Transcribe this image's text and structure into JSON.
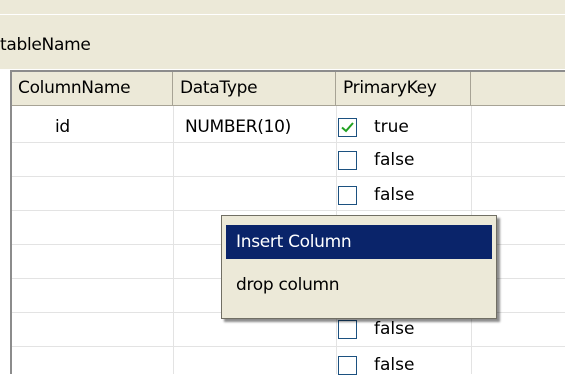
{
  "table_name_label": "tableName",
  "columns": [
    "ColumnName",
    "DataType",
    "PrimaryKey"
  ],
  "rows": [
    {
      "column_name": "id",
      "data_type": "NUMBER(10)",
      "primary_key": "true",
      "checked": true
    },
    {
      "column_name": "",
      "data_type": "",
      "primary_key": "false",
      "checked": false
    },
    {
      "column_name": "",
      "data_type": "",
      "primary_key": "false",
      "checked": false
    },
    {
      "column_name": "",
      "data_type": "",
      "primary_key": "false",
      "checked": false
    },
    {
      "column_name": "",
      "data_type": "",
      "primary_key": "false",
      "checked": false
    }
  ],
  "context_menu": {
    "items": [
      "Insert Column",
      "drop column"
    ],
    "highlighted_index": 0
  },
  "colors": {
    "menu_highlight": "#0a246a",
    "window_bg": "#ece9d8"
  }
}
